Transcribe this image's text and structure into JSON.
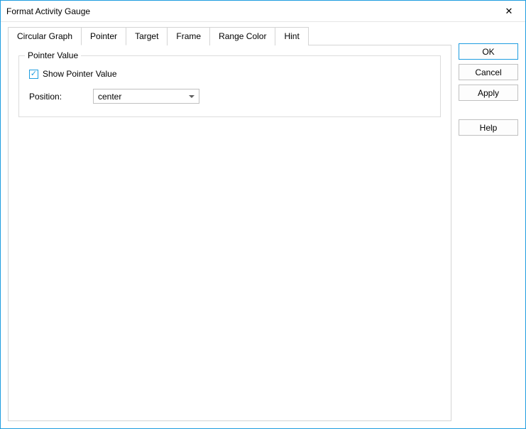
{
  "window": {
    "title": "Format Activity Gauge"
  },
  "tabs": {
    "circular_graph": "Circular Graph",
    "pointer": "Pointer",
    "target": "Target",
    "frame": "Frame",
    "range_color": "Range Color",
    "hint": "Hint"
  },
  "pointer_panel": {
    "group_label": "Pointer Value",
    "show_pointer_value_label": "Show Pointer Value",
    "show_pointer_value_checked": "✓",
    "position_label": "Position:",
    "position_value": "center"
  },
  "buttons": {
    "ok": "OK",
    "cancel": "Cancel",
    "apply": "Apply",
    "help": "Help"
  }
}
